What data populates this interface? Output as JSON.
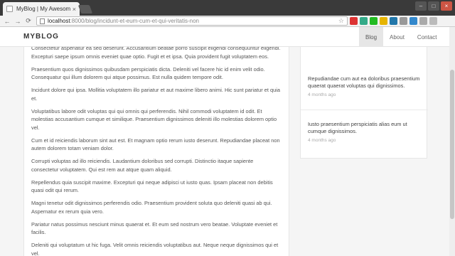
{
  "browser": {
    "tab_title": "MyBlog | My Awesome Blog",
    "tab_close": "×",
    "url_host": "localhost",
    "url_path": ":8000/blog/incidunt-et-eum-cum-et-qui-veritatis-non",
    "win_minimize": "–",
    "win_maximize": "□",
    "win_close": "×",
    "back": "←",
    "forward": "→",
    "reload": "⟳",
    "star": "☆"
  },
  "extensions": [
    {
      "name": "extension-1",
      "color": "#d33"
    },
    {
      "name": "extension-2",
      "color": "#3a8"
    },
    {
      "name": "extension-3",
      "color": "#2b2"
    },
    {
      "name": "extension-4",
      "color": "#e6b400"
    },
    {
      "name": "extension-5",
      "color": "#27a"
    },
    {
      "name": "extension-6",
      "color": "#999"
    },
    {
      "name": "extension-7",
      "color": "#38c"
    },
    {
      "name": "extension-8",
      "color": "#aaa"
    },
    {
      "name": "extension-9",
      "color": "#bbb"
    }
  ],
  "site": {
    "brand": "MYBLOG",
    "nav": [
      {
        "label": "Blog",
        "active": true
      },
      {
        "label": "About",
        "active": false
      },
      {
        "label": "Contact",
        "active": false
      }
    ]
  },
  "post": {
    "paragraphs": [
      "Consectetur asperiatur ea sed deserunt. Accusantium beatae porro suscipit eligendi consequuntur eligendi. Excepturi saepe ipsum omnis eveniet quae optio. Fugit et et ipsa. Quia provident fugit voluptatem eos.",
      "Praesentium quos dignissimos quibusdam perspiciatis dicta. Deleniti vel facere hic id enim velit odio. Consequatur qui illum dolorem qui atque possimus. Est nulla quidem tempore odit.",
      "Incidunt dolore qui ipsa. Mollitia voluptatem illo pariatur et aut maxime libero animi. Hic sunt pariatur et quia et.",
      "Voluptatibus labore odit voluptas qui qui omnis qui perferendis. Nihil commodi voluptatem id odit. Et molestias accusantium cumque et similique. Praesentium dignissimos deleniti illo molestias dolorem optio vel.",
      "Cum et id reiciendis laborum sint aut est. Et magnam optio rerum iusto deserunt. Repudiandae placeat non autem dolorem totam veniam dolor.",
      "Corrupti voluptas ad illo reiciendis. Laudantium doloribus sed corrupti. Distinctio itaque sapiente consectetur voluptatem. Qui est rem aut atque quam aliquid.",
      "Repellendus quia suscipit maxime. Excepturi qui neque adipisci ut iusto quas. Ipsam placeat non debitis quasi odit qui rerum.",
      "Magni tenetur odit dignissimos perferendis odio. Praesentium provident soluta quo deleniti quasi ab qui. Aspernatur ex rerum quia vero.",
      "Pariatur natus possimus nesciunt minus quaerat et. Et eum sed nostrum vero beatae. Voluptate eveniet et facilis.",
      "Deleniti qui voluptatum ut hic fuga. Velit omnis reiciendis voluptatibus aut. Neque neque dignissimos qui et vel."
    ]
  },
  "sidebar": {
    "items": [
      {
        "title": "Repudiandae cum aut ea doloribus praesentium quaerat quaerat voluptas qui dignissimos.",
        "date": "4 months ago"
      },
      {
        "title": "Iusto praesentium perspiciatis alias eum ut cumque dignissimos.",
        "date": "4 months ago"
      }
    ]
  }
}
